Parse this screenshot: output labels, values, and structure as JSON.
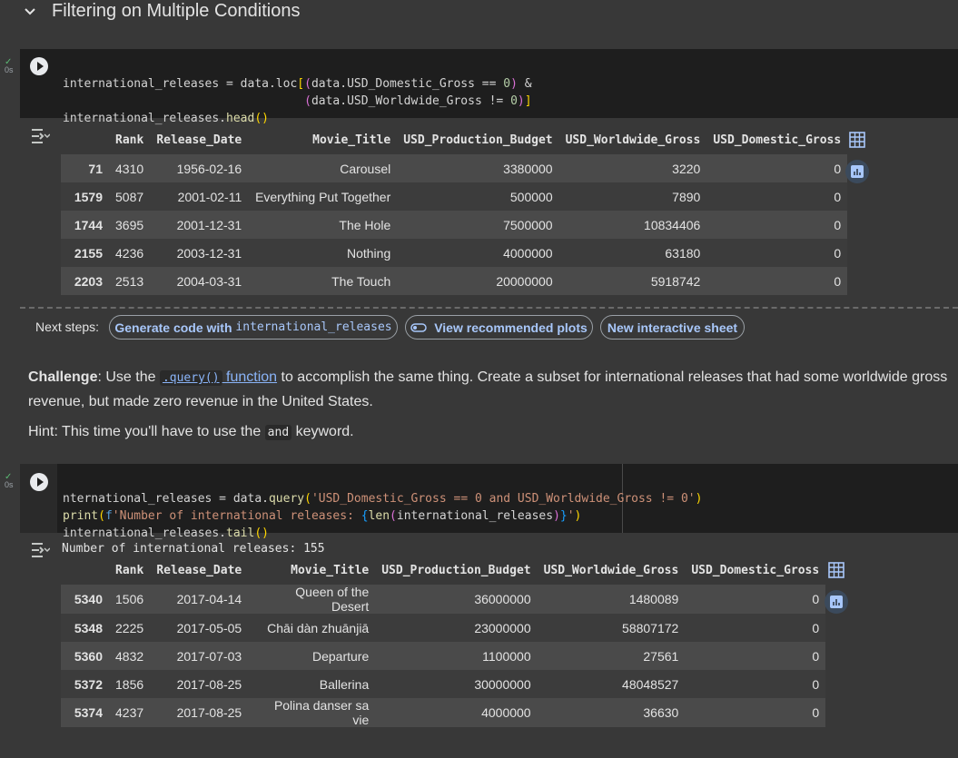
{
  "section": {
    "title": "Filtering on Multiple Conditions"
  },
  "cell1": {
    "status_time": "0s",
    "code_lines": [
      "international_releases = data.loc[(data.USD_Domestic_Gross == 0) &",
      "                                  (data.USD_Worldwide_Gross != 0)]",
      "international_releases.head()"
    ]
  },
  "table_columns": [
    "",
    "Rank",
    "Release_Date",
    "Movie_Title",
    "USD_Production_Budget",
    "USD_Worldwide_Gross",
    "USD_Domestic_Gross"
  ],
  "table1": {
    "rows": [
      [
        "71",
        "4310",
        "1956-02-16",
        "Carousel",
        "3380000",
        "3220",
        "0"
      ],
      [
        "1579",
        "5087",
        "2001-02-11",
        "Everything Put Together",
        "500000",
        "7890",
        "0"
      ],
      [
        "1744",
        "3695",
        "2001-12-31",
        "The Hole",
        "7500000",
        "10834406",
        "0"
      ],
      [
        "2155",
        "4236",
        "2003-12-31",
        "Nothing",
        "4000000",
        "63180",
        "0"
      ],
      [
        "2203",
        "2513",
        "2004-03-31",
        "The Touch",
        "20000000",
        "5918742",
        "0"
      ]
    ]
  },
  "next_steps": {
    "label": "Next steps:",
    "chip1_text": "Generate code with ",
    "chip1_code": "international_releases",
    "chip2": "View recommended plots",
    "chip3": "New interactive sheet"
  },
  "markdown": {
    "challenge_bold": "Challenge",
    "challenge_1": ": Use the ",
    "challenge_code": ".query()",
    "challenge_link": " function",
    "challenge_2": " to accomplish the same thing. Create a subset for international releases that had some worldwide gross revenue, but made zero revenue in the United States.",
    "hint_1": "Hint: This time you'll have to use the ",
    "hint_code": "and",
    "hint_2": " keyword."
  },
  "cell2": {
    "status_time": "0s",
    "output_text": "Number of international releases: 155"
  },
  "table2": {
    "rows": [
      [
        "5340",
        "1506",
        "2017-04-14",
        "Queen of the Desert",
        "36000000",
        "1480089",
        "0"
      ],
      [
        "5348",
        "2225",
        "2017-05-05",
        "Chāi dàn zhuānjiā",
        "23000000",
        "58807172",
        "0"
      ],
      [
        "5360",
        "4832",
        "2017-07-03",
        "Departure",
        "1100000",
        "27561",
        "0"
      ],
      [
        "5372",
        "1856",
        "2017-08-25",
        "Ballerina",
        "30000000",
        "48048527",
        "0"
      ],
      [
        "5374",
        "4237",
        "2017-08-25",
        "Polina danser sa vie",
        "4000000",
        "36630",
        "0"
      ]
    ]
  },
  "colors": {
    "link": "#8ab4f8",
    "chip_text": "#a8c7fa",
    "success": "#5bb974"
  }
}
